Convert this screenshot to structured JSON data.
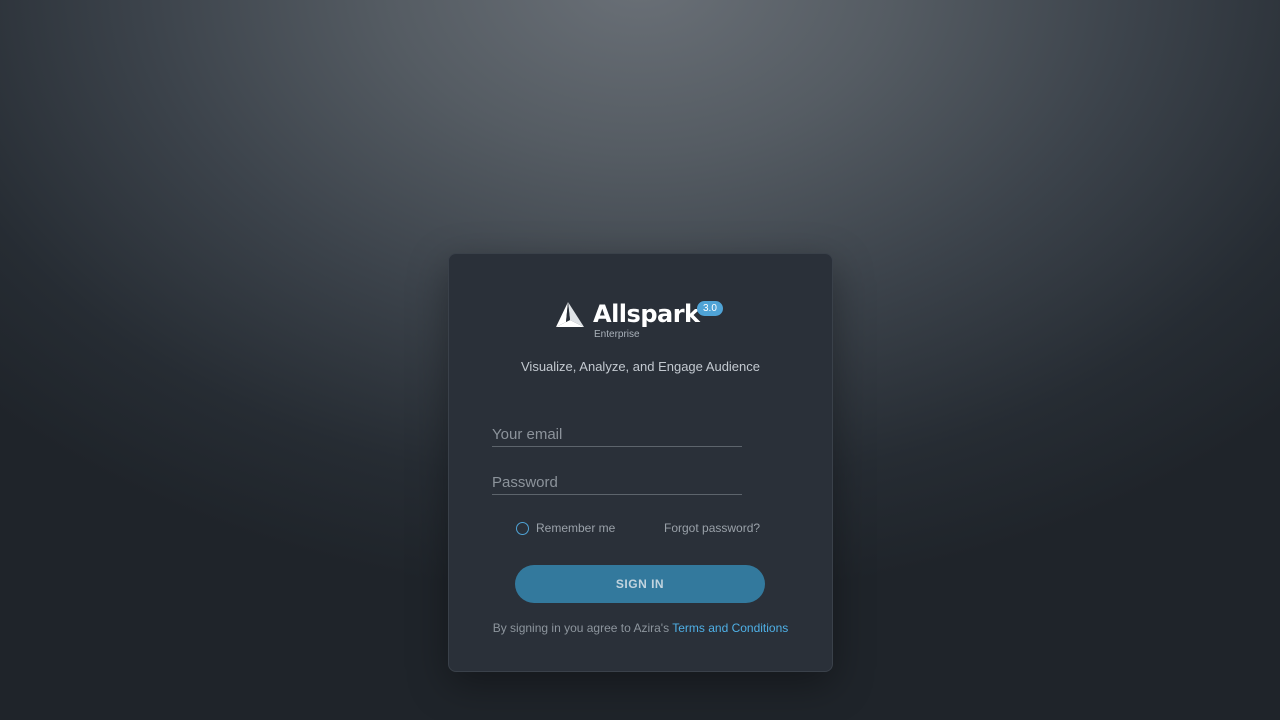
{
  "logo": {
    "icon": "allspark-logo-icon",
    "name": "Allspark",
    "version": "3.0",
    "edition": "Enterprise"
  },
  "tagline": "Visualize, Analyze, and Engage Audience",
  "form": {
    "email_placeholder": "Your email",
    "email_value": "",
    "password_placeholder": "Password",
    "password_value": "",
    "remember_label": "Remember me",
    "forgot_label": "Forgot password?",
    "signin_label": "SIGN IN"
  },
  "terms": {
    "prefix": "By signing in you agree to Azira's ",
    "link_label": "Terms and Conditions"
  },
  "colors": {
    "accent": "#4fa3d6",
    "button": "#33799d",
    "card": "#2a3039",
    "link": "#4fb0e6"
  }
}
